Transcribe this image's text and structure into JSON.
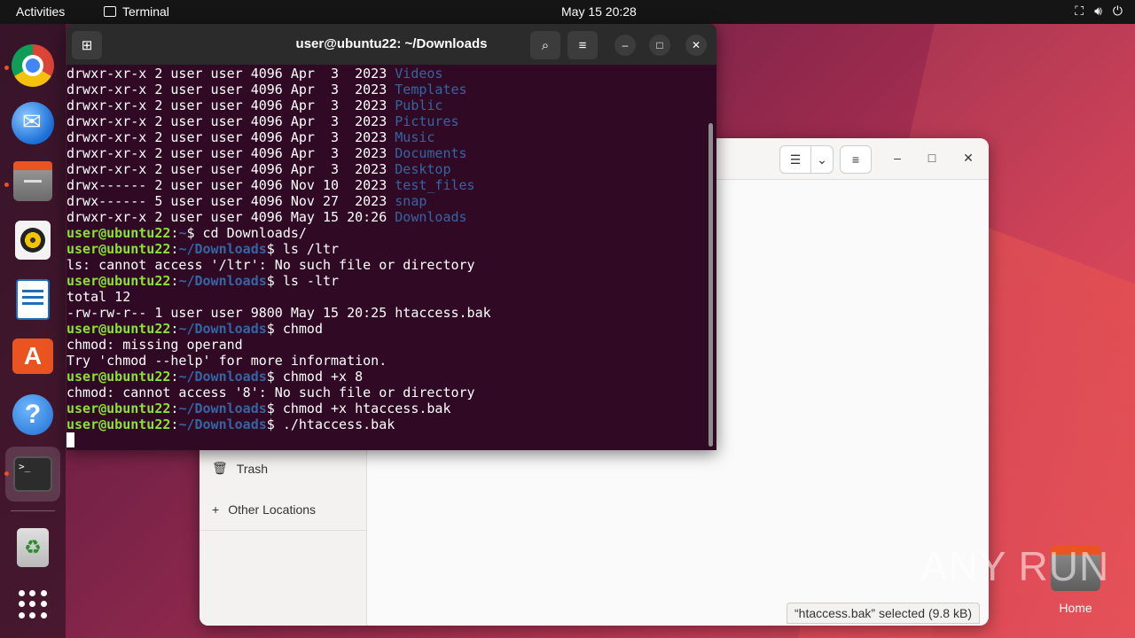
{
  "topbar": {
    "activities": "Activities",
    "app_name": "Terminal",
    "clock": "May 15  20:28",
    "tray_icons": [
      "network-icon",
      "volume-icon",
      "power-icon"
    ]
  },
  "dock": {
    "items": [
      {
        "name": "chrome",
        "running": true
      },
      {
        "name": "thunderbird",
        "running": false
      },
      {
        "name": "files",
        "running": true
      },
      {
        "name": "rhythmbox",
        "running": false
      },
      {
        "name": "libreoffice-writer",
        "running": false
      },
      {
        "name": "app-center",
        "running": false
      },
      {
        "name": "help",
        "running": false
      },
      {
        "name": "terminal",
        "running": true
      },
      {
        "name": "trash",
        "running": false
      },
      {
        "name": "show-apps",
        "running": false
      }
    ]
  },
  "files_window": {
    "sidebar": {
      "trash": "Trash",
      "other_locations": "Other Locations"
    },
    "status": "“htaccess.bak” selected  (9.8 kB)"
  },
  "terminal": {
    "title": "user@ubuntu22: ~/Downloads",
    "prompt_user": "user@ubuntu22",
    "listing": [
      {
        "perm": "drwxr-xr-x 2 user user 4096 Apr  3  2023 ",
        "name": "Videos"
      },
      {
        "perm": "drwxr-xr-x 2 user user 4096 Apr  3  2023 ",
        "name": "Templates"
      },
      {
        "perm": "drwxr-xr-x 2 user user 4096 Apr  3  2023 ",
        "name": "Public"
      },
      {
        "perm": "drwxr-xr-x 2 user user 4096 Apr  3  2023 ",
        "name": "Pictures"
      },
      {
        "perm": "drwxr-xr-x 2 user user 4096 Apr  3  2023 ",
        "name": "Music"
      },
      {
        "perm": "drwxr-xr-x 2 user user 4096 Apr  3  2023 ",
        "name": "Documents"
      },
      {
        "perm": "drwxr-xr-x 2 user user 4096 Apr  3  2023 ",
        "name": "Desktop"
      },
      {
        "perm": "drwx------ 2 user user 4096 Nov 10  2023 ",
        "name": "test_files"
      },
      {
        "perm": "drwx------ 5 user user 4096 Nov 27  2023 ",
        "name": "snap"
      },
      {
        "perm": "drwxr-xr-x 2 user user 4096 May 15 20:26 ",
        "name": "Downloads"
      }
    ],
    "session": [
      {
        "type": "prompt",
        "path": "~",
        "cmd": "$ cd Downloads/"
      },
      {
        "type": "prompt",
        "path": "~/Downloads",
        "cmd": "$ ls /ltr"
      },
      {
        "type": "out",
        "text": "ls: cannot access '/ltr': No such file or directory"
      },
      {
        "type": "prompt",
        "path": "~/Downloads",
        "cmd": "$ ls -ltr"
      },
      {
        "type": "out",
        "text": "total 12"
      },
      {
        "type": "out",
        "text": "-rw-rw-r-- 1 user user 9800 May 15 20:25 htaccess.bak"
      },
      {
        "type": "prompt",
        "path": "~/Downloads",
        "cmd": "$ chmod"
      },
      {
        "type": "out",
        "text": "chmod: missing operand"
      },
      {
        "type": "out",
        "text": "Try 'chmod --help' for more information."
      },
      {
        "type": "prompt",
        "path": "~/Downloads",
        "cmd": "$ chmod +x 8"
      },
      {
        "type": "out",
        "text": "chmod: cannot access '8': No such file or directory"
      },
      {
        "type": "prompt",
        "path": "~/Downloads",
        "cmd": "$ chmod +x htaccess.bak"
      },
      {
        "type": "prompt",
        "path": "~/Downloads",
        "cmd": "$ ./htaccess.bak"
      }
    ]
  },
  "desktop": {
    "home_label": "Home",
    "watermark": "ANY RUN"
  }
}
